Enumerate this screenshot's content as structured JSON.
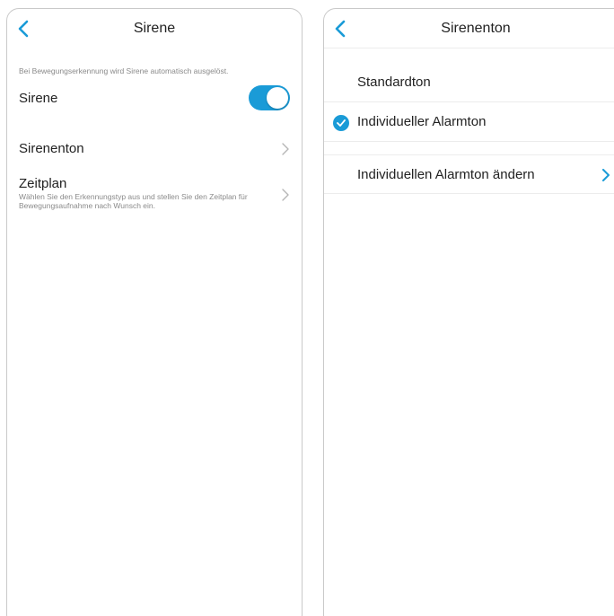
{
  "left_screen": {
    "title": "Sirene",
    "hint": "Bei Bewegungserkennung wird Sirene automatisch ausgelöst.",
    "siren_label": "Sirene",
    "siren_enabled": true,
    "sirenenton_label": "Sirenenton",
    "zeitplan_label": "Zeitplan",
    "zeitplan_desc": "Wählen Sie den Erkennungstyp aus und stellen Sie den Zeitplan für Bewegungsaufnahme nach Wunsch ein."
  },
  "right_screen": {
    "title": "Sirenenton",
    "options": [
      {
        "label": "Standardton",
        "selected": false
      },
      {
        "label": "Individueller Alarmton",
        "selected": true
      }
    ],
    "change_label": "Individuellen Alarmton ändern"
  },
  "colors": {
    "accent": "#1a9bd7",
    "text": "#222222",
    "secondary_text": "#8a8a8a",
    "divider": "#ececec"
  },
  "icons": {
    "back": "chevron-left-icon",
    "row_arrow": "chevron-right-icon",
    "selected": "check-circle-icon"
  }
}
